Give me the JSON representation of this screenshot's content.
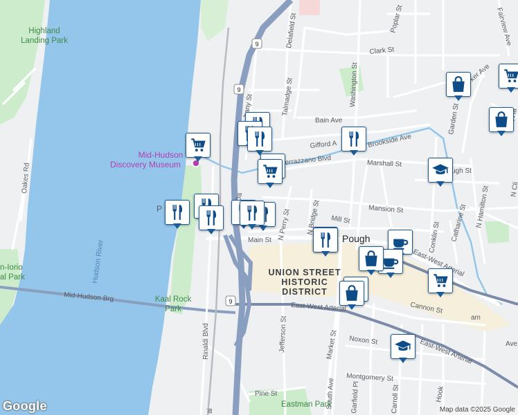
{
  "map": {
    "google_logo": "Google",
    "attribution": "Map data ©2025 Google",
    "colors": {
      "water": "#93c6ea",
      "park": "#cdeccc",
      "land": "#eef0f2",
      "highway": "#8a9fc0",
      "arterial": "#7b8ba8",
      "marker_border": "#1a5b9a",
      "marker_icon": "#0e4c88",
      "poi_label": "#b23fb2"
    },
    "labels": {
      "highland_landing_park": "Highland\nLanding Park",
      "oakes_rd": "Oakes Rd",
      "hudson_river": "Hudson River",
      "mid_hudson_discovery_museum_1": "Mid-Hudson",
      "mid_hudson_discovery_museum_2": "Discovery Museum",
      "kaal_rock_park_1": "Kaal Rock",
      "kaal_rock_park_2": "Park",
      "mid_hudson_brg": "Mid-Hudson Brg",
      "rinaldi_blvd": "Rinaldi Blvd",
      "route_9": "9",
      "union_street_1": "UNION STREET",
      "union_street_2": "HISTORIC",
      "union_street_3": "DISTRICT",
      "main_st": "Main St",
      "mill_st": "Mill St",
      "mansion_st": "Mansion St",
      "marshall_st": "Marshall St",
      "gifford_ave": "Gifford A",
      "brookside_ave": "Brookside Ave",
      "verrazzano_blvd": "errazzano Blvd",
      "bain_ave": "Bain Ave",
      "talmadge_st": "Talmadge St",
      "delafield_st": "Delafield St",
      "washington_st": "Washington St",
      "clark_st": "Clark St",
      "poplar_st": "Poplar St",
      "fairview_ave": "Fairview Ave",
      "parker_ave": "Parker Ave",
      "garden_st": "Garden St",
      "conklin_st": "Conklin St",
      "catharine_st": "Catharine St",
      "n_hamilton_st": "N Hamilton St",
      "n_perry_st": "N Perry St",
      "n_bridge_st": "N Bridge St",
      "jefferson_st": "Jefferson St",
      "market_st": "Market St",
      "south_ave": "South Ave",
      "noxon_st": "Noxon St",
      "cannon_st": "Cannon St",
      "east_west_arterial_1": "East-West Arterial",
      "east_west_arterial_2": "East-West Arterial",
      "east_west_arterial_3": "East-West Arterial",
      "montgomery_st": "Montgomery St",
      "pine_st": "Pine St",
      "eastman_park": "Eastman Park",
      "garfield_pl": "Garfield Pl",
      "carroll_st": "Carroll St",
      "hooker": "Hook",
      "pough": "Pough",
      "lorio_park": "n-Iorio\nal Park",
      "bany_st": "bany St",
      "ugh_st": "ugh St",
      "ave_frag": "Ave",
      "da_frag": "Da",
      "p_frag": "P",
      "n_cli": "N Cli",
      "n_ha": "N Ha",
      "am_frag": "am",
      "ai_frag": "ai"
    },
    "markers": [
      {
        "type": "grocery",
        "icon": "shopping-cart-icon"
      },
      {
        "type": "restaurant",
        "icon": "fork-knife-icon"
      },
      {
        "type": "restaurant",
        "icon": "fork-knife-icon"
      },
      {
        "type": "restaurant",
        "icon": "fork-knife-icon"
      },
      {
        "type": "grocery",
        "icon": "shopping-cart-icon"
      },
      {
        "type": "restaurant",
        "icon": "fork-knife-icon"
      },
      {
        "type": "restaurant",
        "icon": "fork-knife-icon"
      },
      {
        "type": "restaurant",
        "icon": "fork-knife-icon"
      },
      {
        "type": "restaurant",
        "icon": "fork-knife-icon"
      },
      {
        "type": "restaurant",
        "icon": "fork-knife-icon"
      },
      {
        "type": "restaurant",
        "icon": "fork-knife-icon"
      },
      {
        "type": "restaurant",
        "icon": "fork-knife-icon"
      },
      {
        "type": "restaurant",
        "icon": "fork-knife-icon"
      },
      {
        "type": "cafe",
        "icon": "coffee-cup-icon"
      },
      {
        "type": "cafe",
        "icon": "coffee-cup-icon"
      },
      {
        "type": "shopping",
        "icon": "shopping-bag-icon"
      },
      {
        "type": "shopping",
        "icon": "shopping-bag-icon"
      },
      {
        "type": "shopping",
        "icon": "shopping-bag-icon"
      },
      {
        "type": "shopping",
        "icon": "shopping-bag-icon"
      },
      {
        "type": "shopping",
        "icon": "shopping-bag-icon"
      },
      {
        "type": "grocery",
        "icon": "shopping-cart-icon"
      },
      {
        "type": "grocery",
        "icon": "shopping-cart-icon"
      },
      {
        "type": "grocery",
        "icon": "shopping-cart-icon"
      },
      {
        "type": "school",
        "icon": "graduation-cap-icon"
      },
      {
        "type": "school",
        "icon": "graduation-cap-icon"
      },
      {
        "type": "restaurant",
        "icon": "fork-knife-icon"
      }
    ]
  }
}
